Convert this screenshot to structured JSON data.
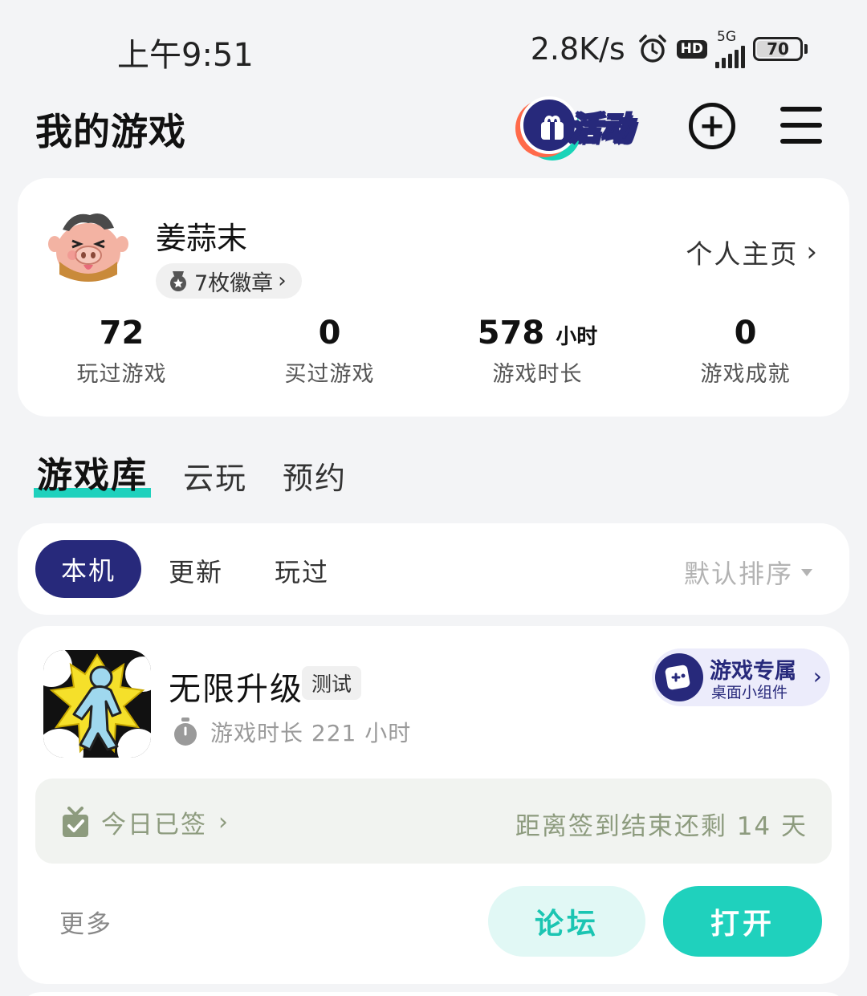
{
  "status_bar": {
    "time": "上午9:51",
    "net_speed": "2.8K/s",
    "hd": "HD",
    "network": "5G",
    "battery": "70",
    "battery_level": 0.7
  },
  "header": {
    "title": "我的游戏",
    "activity_label": "活动"
  },
  "profile": {
    "username": "姜蒜末",
    "badges": "7枚徽章",
    "homepage_link": "个人主页",
    "stats": [
      {
        "value": "72",
        "unit": "",
        "label": "玩过游戏"
      },
      {
        "value": "0",
        "unit": "",
        "label": "买过游戏"
      },
      {
        "value": "578",
        "unit": "小时",
        "label": "游戏时长"
      },
      {
        "value": "0",
        "unit": "",
        "label": "游戏成就"
      }
    ]
  },
  "tabs": [
    {
      "label": "游戏库",
      "active": true
    },
    {
      "label": "云玩",
      "active": false
    },
    {
      "label": "预约",
      "active": false
    }
  ],
  "filters": {
    "chips": [
      "本机",
      "更新",
      "玩过"
    ],
    "selected": "本机",
    "sort_label": "默认排序"
  },
  "game": {
    "name": "无限升级",
    "tag": "测试",
    "playtime": "游戏时长 221 小时",
    "widget_title": "游戏专属",
    "widget_subtitle": "桌面小组件",
    "checkin_status": "今日已签",
    "checkin_remaining": "距离签到结束还剩 14 天",
    "more": "更多",
    "forum_button": "论坛",
    "open_button": "打开"
  },
  "colors": {
    "accent": "#1fd1bd",
    "brand_navy": "#27297b",
    "background": "#f3f4f6"
  }
}
